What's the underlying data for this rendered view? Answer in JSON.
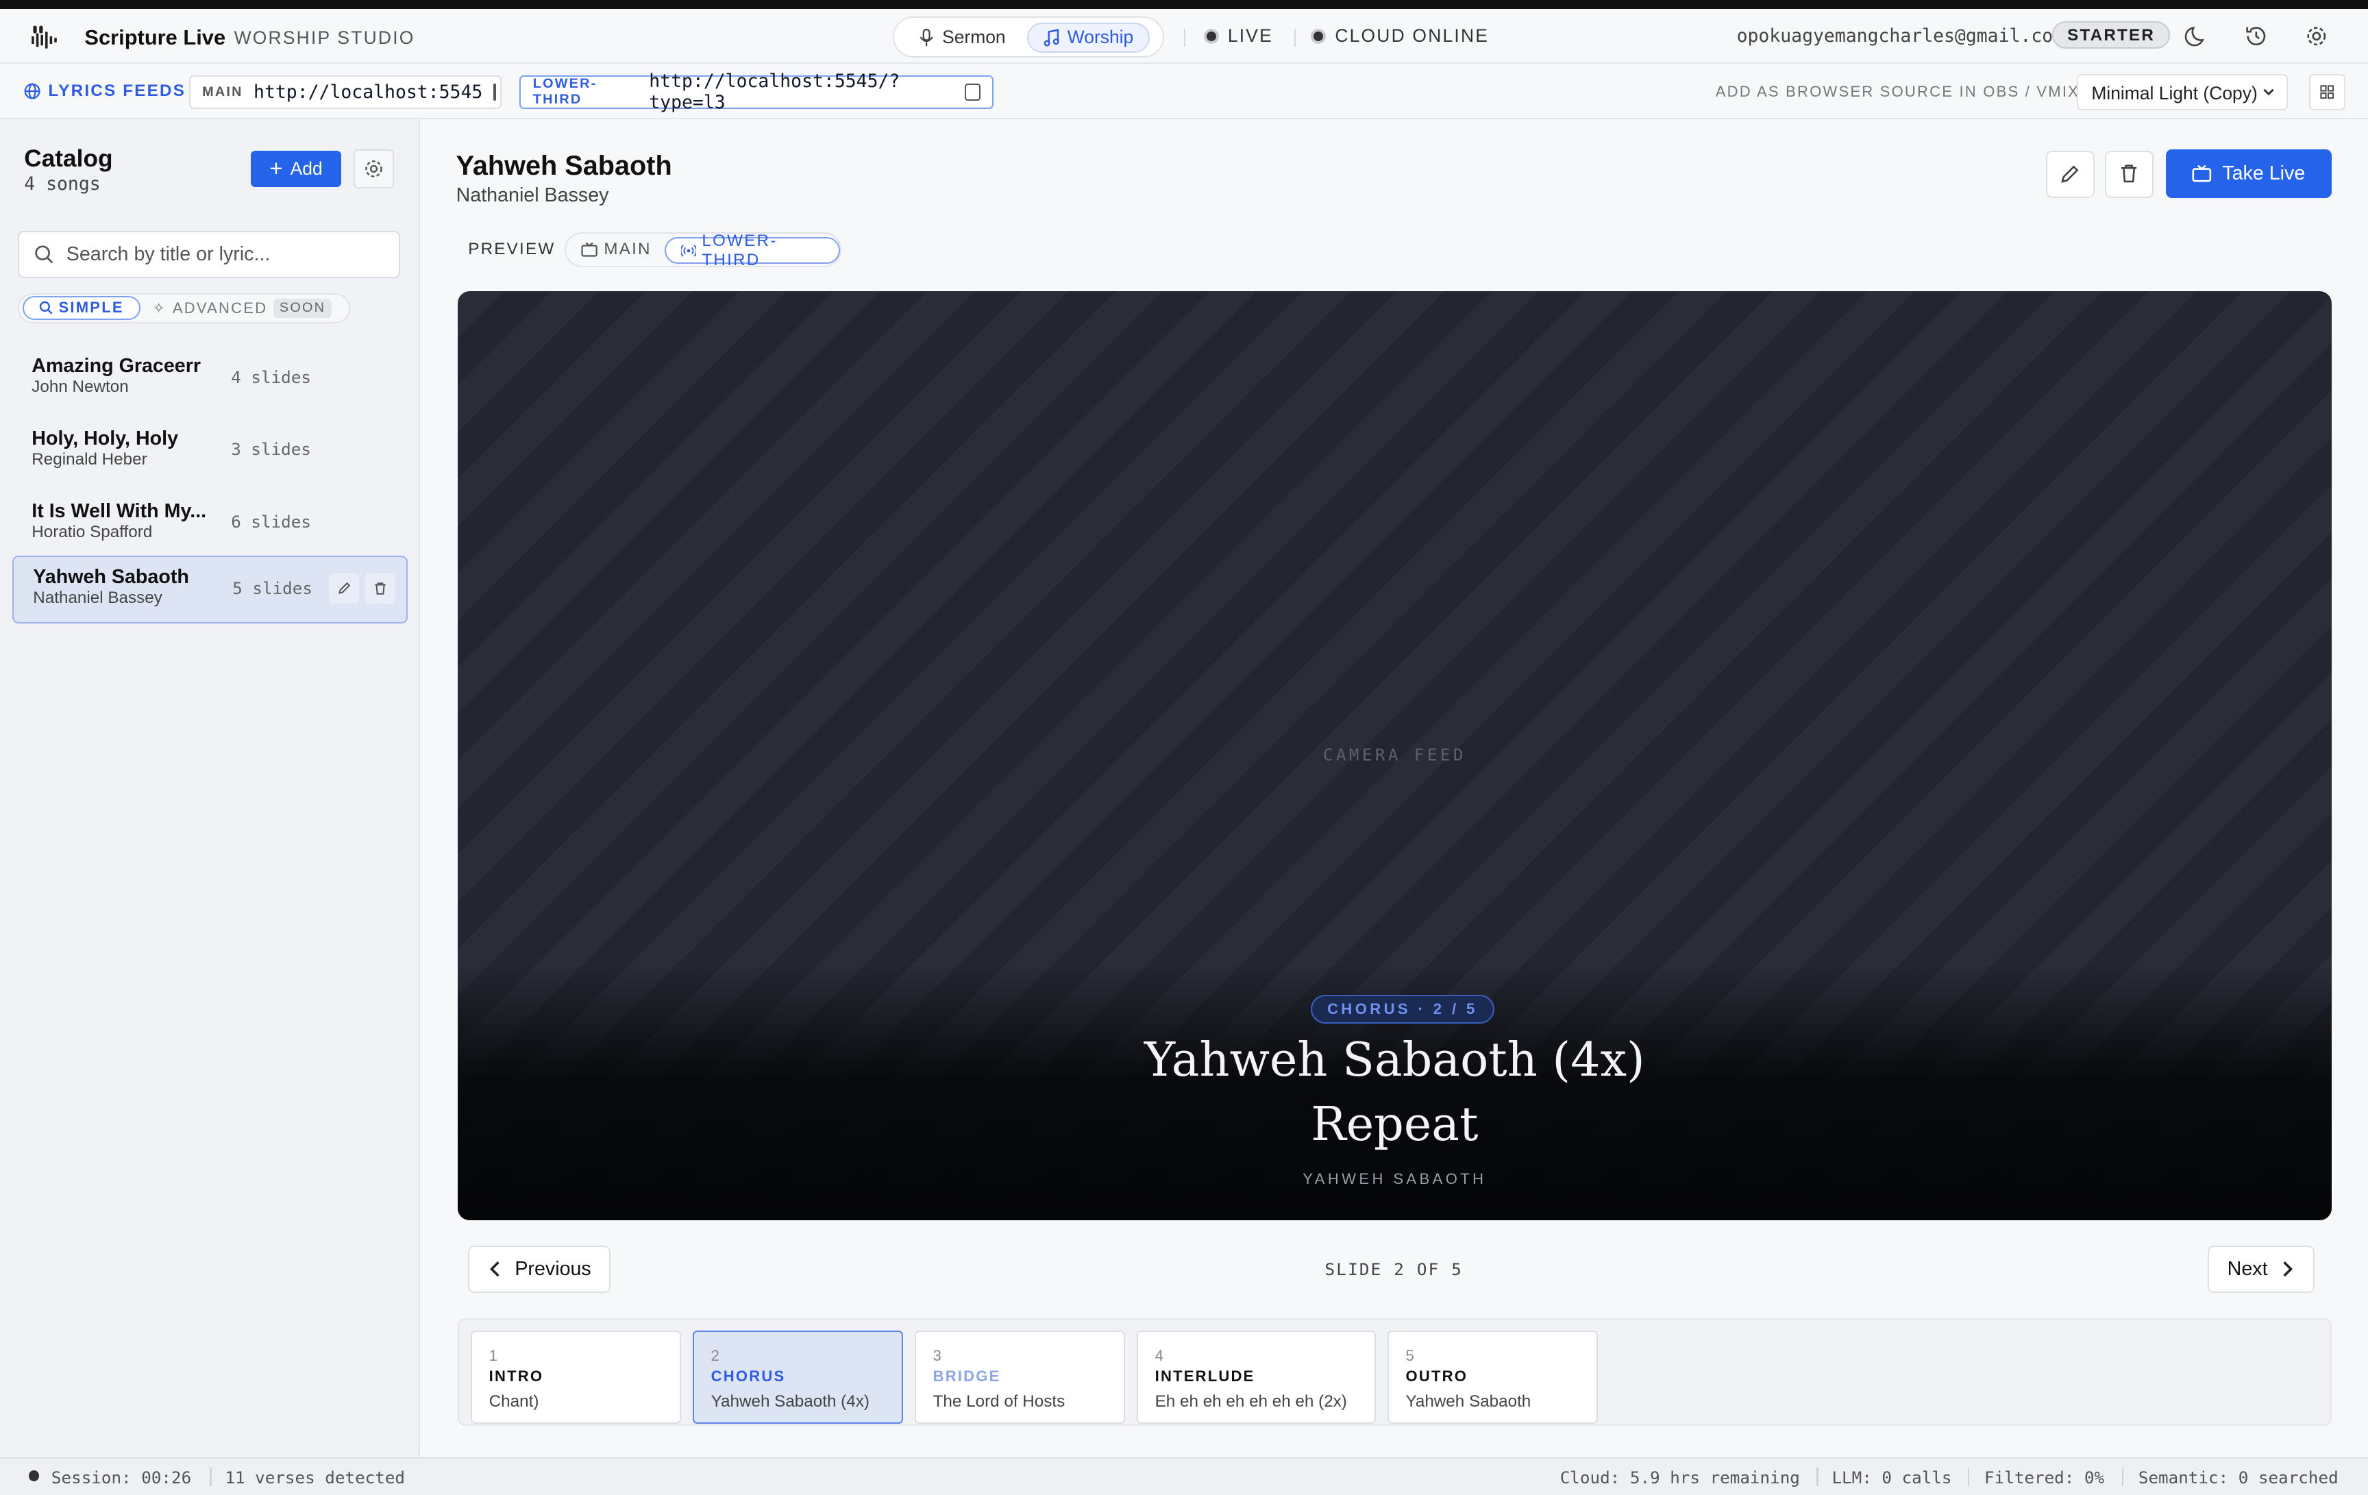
{
  "header": {
    "app_name": "Scripture Live",
    "studio_label": "WORSHIP STUDIO",
    "modes": [
      {
        "label": "Sermon",
        "icon": "microphone-icon"
      },
      {
        "label": "Worship",
        "icon": "music-note-icon"
      }
    ],
    "live_label": "LIVE",
    "cloud_label": "CLOUD ONLINE",
    "email": "opokuagyemangcharles@gmail.com",
    "plan": "STARTER"
  },
  "feeds": {
    "label": "LYRICS FEEDS",
    "main_tag": "MAIN",
    "main_url": "http://localhost:5545",
    "l3_tag": "LOWER-THIRD",
    "l3_url": "http://localhost:5545/?type=l3",
    "obs_hint": "ADD AS BROWSER SOURCE IN OBS / VMIX",
    "theme": "Minimal Light (Copy)"
  },
  "catalog": {
    "title": "Catalog",
    "count": "4 songs",
    "add_label": "Add",
    "search_placeholder": "Search by title or lyric...",
    "mode_simple": "SIMPLE",
    "mode_advanced": "ADVANCED",
    "soon": "SOON",
    "songs": [
      {
        "title": "Amazing Graceerr",
        "author": "John Newton",
        "slides": "4 slides"
      },
      {
        "title": "Holy, Holy, Holy",
        "author": "Reginald Heber",
        "slides": "3 slides"
      },
      {
        "title": "It Is Well With My...",
        "author": "Horatio Spafford",
        "slides": "6 slides"
      },
      {
        "title": "Yahweh Sabaoth",
        "author": "Nathaniel Bassey",
        "slides": "5 slides"
      }
    ]
  },
  "song": {
    "title": "Yahweh Sabaoth",
    "author": "Nathaniel Bassey",
    "take_live": "Take Live"
  },
  "preview": {
    "label": "PREVIEW",
    "main": "MAIN",
    "lower_third": "LOWER-THIRD",
    "camera_label": "CAMERA FEED",
    "section_pill": "CHORUS · 2 / 5",
    "line1": "Yahweh Sabaoth (4x)",
    "line2": "Repeat",
    "footer": "YAHWEH SABAOTH"
  },
  "nav": {
    "previous": "Previous",
    "next": "Next",
    "counter": "SLIDE 2 OF 5"
  },
  "slides": [
    {
      "num": "1",
      "section": "INTRO",
      "text": "Chant)"
    },
    {
      "num": "2",
      "section": "CHORUS",
      "text": "Yahweh Sabaoth (4x)"
    },
    {
      "num": "3",
      "section": "BRIDGE",
      "text": "The Lord of Hosts"
    },
    {
      "num": "4",
      "section": "INTERLUDE",
      "text": "Eh eh eh eh eh eh eh (2x)"
    },
    {
      "num": "5",
      "section": "OUTRO",
      "text": "Yahweh Sabaoth"
    }
  ],
  "statusbar": {
    "session": "Session: 00:26",
    "verses": "11 verses detected",
    "cloud": "Cloud: 5.9 hrs remaining",
    "llm": "LLM: 0 calls",
    "filtered": "Filtered: 0%",
    "semantic": "Semantic: 0 searched"
  },
  "colors": {
    "accent": "#2563eb",
    "accent_text": "#2d5be3",
    "stage_dark": "#2a2d38",
    "active_row": "#dde5f5"
  }
}
